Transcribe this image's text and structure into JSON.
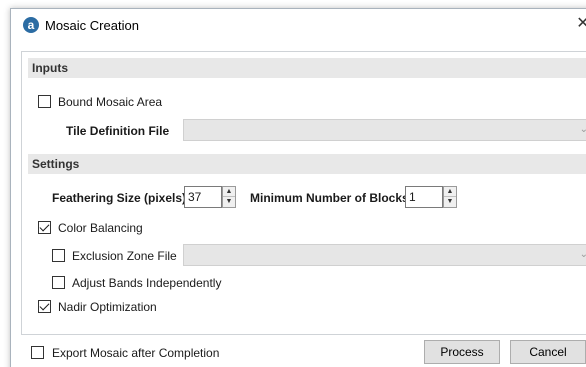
{
  "window": {
    "title": "Mosaic Creation",
    "app_icon_glyph": "a",
    "close_glyph": "✕"
  },
  "inputs": {
    "header": "Inputs",
    "bound_mosaic_area": {
      "label": "Bound Mosaic Area",
      "checked": false
    },
    "tile_definition_file": {
      "label": "Tile Definition File",
      "value": ""
    }
  },
  "settings": {
    "header": "Settings",
    "feathering_size": {
      "label": "Feathering Size (pixels)",
      "value": "37"
    },
    "minimum_blocks": {
      "label": "Minimum Number of Blocks",
      "value": "1"
    },
    "color_balancing": {
      "label": "Color Balancing",
      "checked": true
    },
    "exclusion_zone_file": {
      "label": "Exclusion Zone File",
      "checked": false,
      "value": ""
    },
    "adjust_bands": {
      "label": "Adjust Bands Independently",
      "checked": false
    },
    "nadir_optimization": {
      "label": "Nadir Optimization",
      "checked": true
    }
  },
  "footer": {
    "export_after_completion": {
      "label": "Export Mosaic after Completion",
      "checked": false
    },
    "process_label": "Process",
    "cancel_label": "Cancel"
  },
  "icons": {
    "chevron": "chevron-down-icon",
    "spin_up": "▲",
    "spin_down": "▼"
  },
  "colors": {
    "app_icon": "#2b6ca3",
    "section_header_bg": "#e8e8e8",
    "disabled_combo_bg": "#e6e6e6"
  }
}
